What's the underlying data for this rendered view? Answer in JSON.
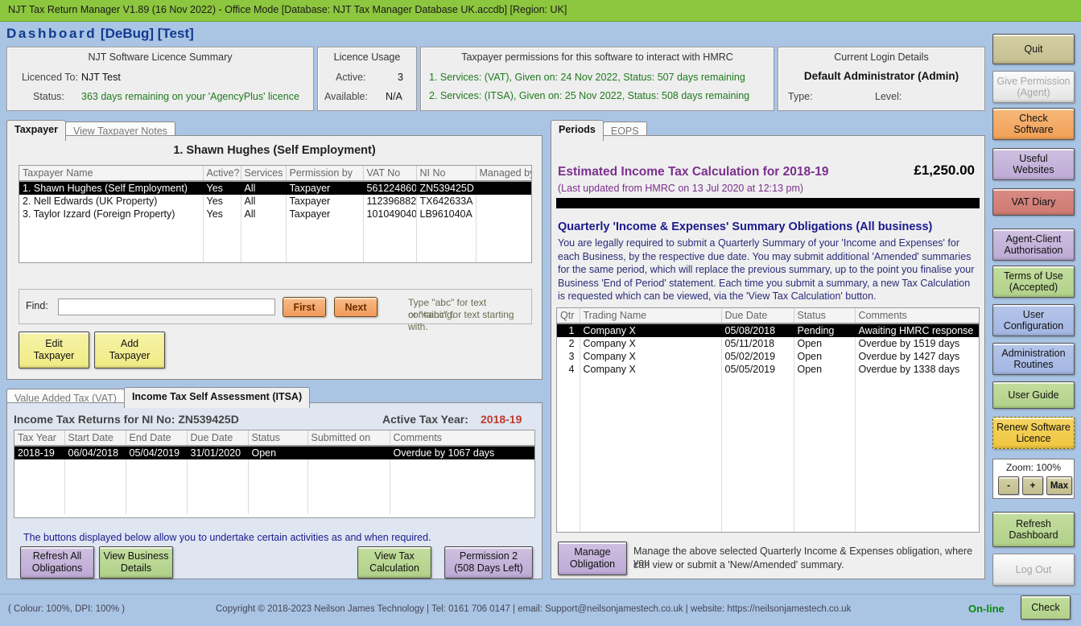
{
  "titlebar": {
    "text": "NJT Tax Return Manager V1.89 (16 Nov 2022) - Office Mode  [Database: NJT Tax Manager Database UK.accdb]  [Region: UK]"
  },
  "dashboard": {
    "title_spaced": "Dashboard",
    "title_tags": " [DeBug] [Test]"
  },
  "panels": {
    "licence": {
      "header": "NJT Software Licence Summary",
      "licenced_to_label": "Licenced To:",
      "licenced_to_value": "NJT Test",
      "status_label": "Status:",
      "status_value": "363 days remaining on your 'AgencyPlus' licence"
    },
    "usage": {
      "header": "Licence Usage",
      "active_label": "Active:",
      "active_value": "3",
      "available_label": "Available:",
      "available_value": "N/A"
    },
    "permissions": {
      "header": "Taxpayer permissions for this software to interact with HMRC",
      "line1": "1. Services: (VAT), Given on: 24 Nov 2022, Status: 507 days remaining",
      "line2": "2. Services: (ITSA), Given on: 25 Nov 2022, Status: 508 days remaining"
    },
    "login": {
      "header": "Current Login Details",
      "user": "Default Administrator (Admin)",
      "type_label": "Type:",
      "level_label": "Level:"
    }
  },
  "sidebar": {
    "buttons": [
      {
        "label": "Quit",
        "name": "quit-button",
        "color": "c-khaki",
        "disabled": false
      },
      {
        "label": "Give Permission\n(Agent)",
        "name": "give-permission-agent-button",
        "color": "c-grey",
        "disabled": true
      },
      {
        "label": "Check\nSoftware",
        "name": "check-software-button",
        "color": "c-orange",
        "disabled": false
      },
      {
        "label": "Useful\nWebsites",
        "name": "useful-websites-button",
        "color": "c-purple",
        "disabled": false
      },
      {
        "label": "VAT Diary",
        "name": "vat-diary-button",
        "color": "c-red",
        "disabled": false
      },
      {
        "label": "Agent-Client\nAuthorisation",
        "name": "agent-client-authorisation-button",
        "color": "c-purple",
        "disabled": false
      },
      {
        "label": "Terms of Use\n(Accepted)",
        "name": "terms-of-use-button",
        "color": "c-green",
        "disabled": false
      },
      {
        "label": "User\nConfiguration",
        "name": "user-configuration-button",
        "color": "c-blue",
        "disabled": false
      },
      {
        "label": "Administration\nRoutines",
        "name": "administration-routines-button",
        "color": "c-blue",
        "disabled": false
      },
      {
        "label": "User Guide",
        "name": "user-guide-button",
        "color": "c-green",
        "disabled": false
      },
      {
        "label": "Renew Software\nLicence",
        "name": "renew-software-licence-button",
        "color": "c-yellow",
        "disabled": false
      }
    ],
    "zoom": {
      "label": "Zoom: 100%",
      "minus": "-",
      "plus": "+",
      "max": "Max"
    },
    "refresh_dashboard": "Refresh\nDashboard",
    "log_out": "Log Out"
  },
  "taxpayer_panel": {
    "tabs": [
      {
        "label": "Taxpayer",
        "active": true
      },
      {
        "label": "View Taxpayer Notes",
        "active": false
      }
    ],
    "heading": "1. Shawn Hughes (Self Employment)",
    "columns": [
      "Taxpayer Name",
      "Active?",
      "Services",
      "Permission by",
      "VAT No",
      "NI No",
      "Managed by"
    ],
    "rows": [
      {
        "cells": [
          "1. Shawn Hughes (Self Employment)",
          "Yes",
          "All",
          "Taxpayer",
          "561224860",
          "ZN539425D",
          ""
        ],
        "selected": true
      },
      {
        "cells": [
          "2. Nell Edwards (UK Property)",
          "Yes",
          "All",
          "Taxpayer",
          "112396882",
          "TX642633A",
          ""
        ],
        "selected": false
      },
      {
        "cells": [
          "3. Taylor Izzard (Foreign Property)",
          "Yes",
          "All",
          "Taxpayer",
          "101049040",
          "LB961040A",
          ""
        ],
        "selected": false
      }
    ],
    "find_label": "Find:",
    "find_value": "",
    "first_button": "First",
    "next_button": "Next",
    "hint_line1": "Type \"abc\" for text containing.",
    "hint_line2": "or \"<abc\" for text starting with.",
    "edit_taxpayer": "Edit\nTaxpayer",
    "add_taxpayer": "Add\nTaxpayer"
  },
  "returns_panel": {
    "tabs": [
      {
        "label": "Value Added Tax (VAT)",
        "active": false
      },
      {
        "label": "Income Tax Self Assessment (ITSA)",
        "active": true
      }
    ],
    "heading": "Income Tax Returns  for NI No: ZN539425D",
    "active_tax_year_label": "Active Tax Year:",
    "active_tax_year_value": "2018-19",
    "columns": [
      "Tax Year",
      "Start Date",
      "End Date",
      "Due Date",
      "Status",
      "Submitted on",
      "Comments"
    ],
    "rows": [
      {
        "cells": [
          "2018-19",
          "06/04/2018",
          "05/04/2019",
          "31/01/2020",
          "Open",
          "",
          "Overdue by 1067 days"
        ],
        "selected": true
      }
    ],
    "buttons_note": "The buttons displayed below allow you to undertake certain activities as and when required.",
    "refresh_all_obligations": "Refresh All\nObligations",
    "view_business_details": "View Business\nDetails",
    "view_tax_calculation": "View Tax\nCalculation",
    "permission2": "Permission 2\n(508 Days Left)"
  },
  "periods_panel": {
    "tabs": [
      {
        "label": "Periods",
        "active": true
      },
      {
        "label": "EOPS",
        "active": false
      }
    ],
    "tax_calc_title": "Estimated Income Tax Calculation for 2018-19",
    "tax_calc_amount": "£1,250.00",
    "tax_calc_sub": "(Last updated from HMRC on 13 Jul 2020 at 12:13 pm)",
    "quarterly_title": "Quarterly 'Income & Expenses' Summary Obligations (All business)",
    "quarterly_body": "You are legally required to submit a Quarterly Summary of your 'Income and Expenses' for each Business, by the respective due date.   You may submit additional 'Amended' summaries for the same period, which will replace the previous summary, up to the point you finalise your Business 'End of Period' statement.   Each time you submit a summary, a new Tax Calculation is requested which can be viewed, via the 'View Tax Calculation' button.",
    "columns": [
      "Qtr",
      "Trading Name",
      "Due Date",
      "Status",
      "Comments"
    ],
    "rows": [
      {
        "cells": [
          "1",
          "Company X",
          "05/08/2018",
          "Pending",
          "Awaiting HMRC response"
        ],
        "selected": true
      },
      {
        "cells": [
          "2",
          "Company X",
          "05/11/2018",
          "Open",
          "Overdue by 1519 days"
        ],
        "selected": false
      },
      {
        "cells": [
          "3",
          "Company X",
          "05/02/2019",
          "Open",
          "Overdue by 1427 days"
        ],
        "selected": false
      },
      {
        "cells": [
          "4",
          "Company X",
          "05/05/2019",
          "Open",
          "Overdue by 1338 days"
        ],
        "selected": false
      }
    ],
    "manage_obligation": "Manage\nObligation",
    "manage_note_line1": "Manage the above selected Quarterly Income & Expenses obligation, where you",
    "manage_note_line2": "can view or submit a 'New/Amended' summary."
  },
  "footer": {
    "left": "( Colour: 100%, DPI: 100% )",
    "center": "Copyright © 2018-2023 Neilson James Technology | Tel: 0161 706 0147 | email: Support@neilsonjamestech.co.uk | website: https://neilsonjamestech.co.uk",
    "status": "On-line",
    "check_button": "Check"
  },
  "colors": {
    "titlebar_green": "#8dc63f",
    "app_background": "#aac4e4",
    "heading_blue": "#123a8f",
    "purple_text": "#7b2f8e",
    "navy_text": "#1a1a8c",
    "green_value": "#1f7a1f",
    "red_value": "#c0392b"
  }
}
